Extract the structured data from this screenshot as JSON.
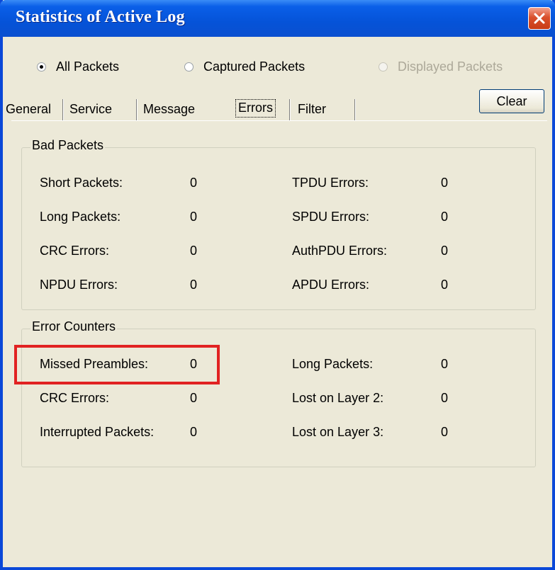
{
  "window": {
    "title": "Statistics of Active Log",
    "close_icon": "close-icon"
  },
  "packet_scope": {
    "options": [
      {
        "label": "All Packets",
        "selected": true,
        "enabled": true
      },
      {
        "label": "Captured Packets",
        "selected": false,
        "enabled": true
      },
      {
        "label": "Displayed Packets",
        "selected": false,
        "enabled": false
      }
    ]
  },
  "tabs": [
    {
      "label": "General"
    },
    {
      "label": "Service"
    },
    {
      "label": "Message"
    },
    {
      "label": "Errors",
      "active": true
    },
    {
      "label": "Filter"
    }
  ],
  "clear_label": "Clear",
  "bad_packets": {
    "title": "Bad Packets",
    "left": [
      {
        "label": "Short Packets:",
        "value": "0"
      },
      {
        "label": "Long Packets:",
        "value": "0"
      },
      {
        "label": "CRC Errors:",
        "value": "0"
      },
      {
        "label": "NPDU Errors:",
        "value": "0"
      }
    ],
    "right": [
      {
        "label": "TPDU Errors:",
        "value": "0"
      },
      {
        "label": "SPDU Errors:",
        "value": "0"
      },
      {
        "label": "AuthPDU Errors:",
        "value": "0"
      },
      {
        "label": "APDU Errors:",
        "value": "0"
      }
    ]
  },
  "error_counters": {
    "title": "Error Counters",
    "left": [
      {
        "label": "Missed Preambles:",
        "value": "0"
      },
      {
        "label": "CRC Errors:",
        "value": "0"
      },
      {
        "label": "Interrupted Packets:",
        "value": "0"
      }
    ],
    "right": [
      {
        "label": "Long Packets:",
        "value": "0"
      },
      {
        "label": "Lost on Layer 2:",
        "value": "0"
      },
      {
        "label": "Lost on Layer 3:",
        "value": "0"
      }
    ]
  },
  "colors": {
    "titlebar": "#0553d8",
    "dialog_bg": "#ece9d8",
    "highlight": "#e12222"
  }
}
